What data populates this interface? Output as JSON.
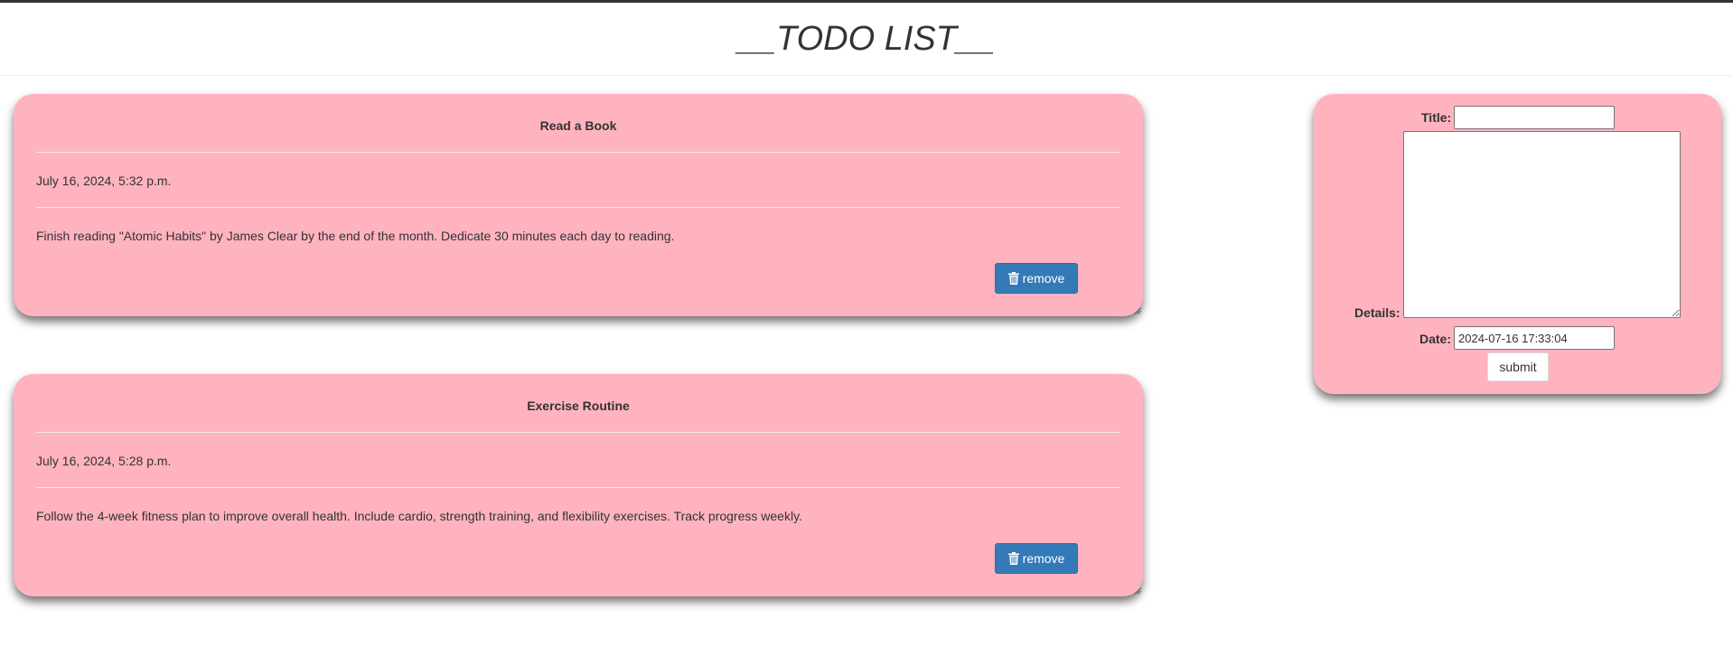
{
  "header": {
    "title": "__TODO LIST__"
  },
  "todos": [
    {
      "title": "Read a Book",
      "date": "July 16, 2024, 5:32 p.m.",
      "details": "Finish reading \"Atomic Habits\" by James Clear by the end of the month. Dedicate 30 minutes each day to reading.",
      "remove_label": "remove"
    },
    {
      "title": "Exercise Routine",
      "date": "July 16, 2024, 5:28 p.m.",
      "details": "Follow the 4-week fitness plan to improve overall health. Include cardio, strength training, and flexibility exercises. Track progress weekly.",
      "remove_label": "remove"
    }
  ],
  "form": {
    "title_label": "Title:",
    "title_value": "",
    "details_label": "Details:",
    "details_value": "",
    "date_label": "Date:",
    "date_value": "2024-07-16 17:33:04",
    "submit_label": "submit"
  },
  "icons": {
    "remove": "trash-icon"
  },
  "colors": {
    "card_background": "#ffb3bf",
    "primary_button": "#337ab7",
    "text": "#333333"
  }
}
